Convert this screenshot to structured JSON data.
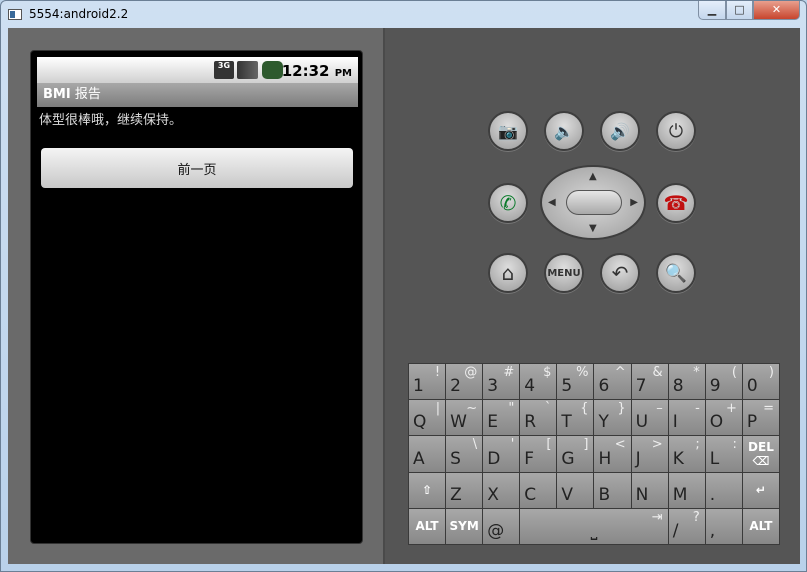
{
  "window": {
    "title": "5554:android2.2",
    "minimize": "▁",
    "maximize": "□",
    "close": "✕"
  },
  "status": {
    "network": "3G",
    "time": "12:32",
    "ampm": "PM"
  },
  "app": {
    "title_bold": "BMI",
    "title_rest": " 报告",
    "message": "体型很棒哦，继续保持。",
    "prev_button": "前一页"
  },
  "controls": {
    "menu": "MENU"
  },
  "keyboard": [
    [
      {
        "m": "1",
        "a": "!"
      },
      {
        "m": "2",
        "a": "@"
      },
      {
        "m": "3",
        "a": "#"
      },
      {
        "m": "4",
        "a": "$"
      },
      {
        "m": "5",
        "a": "%"
      },
      {
        "m": "6",
        "a": "^"
      },
      {
        "m": "7",
        "a": "&"
      },
      {
        "m": "8",
        "a": "*"
      },
      {
        "m": "9",
        "a": "("
      },
      {
        "m": "0",
        "a": ")"
      }
    ],
    [
      {
        "m": "Q",
        "a": "|"
      },
      {
        "m": "W",
        "a": "~"
      },
      {
        "m": "E",
        "a": "\""
      },
      {
        "m": "R",
        "a": "`"
      },
      {
        "m": "T",
        "a": "{"
      },
      {
        "m": "Y",
        "a": "}"
      },
      {
        "m": "U",
        "a": "–"
      },
      {
        "m": "I",
        "a": "-"
      },
      {
        "m": "O",
        "a": "+"
      },
      {
        "m": "P",
        "a": "="
      }
    ],
    [
      {
        "m": "A",
        "a": ""
      },
      {
        "m": "S",
        "a": "\\"
      },
      {
        "m": "D",
        "a": "'"
      },
      {
        "m": "F",
        "a": "["
      },
      {
        "m": "G",
        "a": "]"
      },
      {
        "m": "H",
        "a": "<"
      },
      {
        "m": "J",
        "a": ">"
      },
      {
        "m": "K",
        "a": ";"
      },
      {
        "m": "L",
        "a": ":"
      },
      {
        "c": "DEL ⌫",
        "name": "delete"
      }
    ],
    [
      {
        "c": "⇧",
        "name": "shift"
      },
      {
        "m": "Z",
        "a": ""
      },
      {
        "m": "X",
        "a": ""
      },
      {
        "m": "C",
        "a": ""
      },
      {
        "m": "V",
        "a": ""
      },
      {
        "m": "B",
        "a": ""
      },
      {
        "m": "N",
        "a": ""
      },
      {
        "m": "M",
        "a": ""
      },
      {
        "m": ".",
        "a": ""
      },
      {
        "c": "↵",
        "name": "enter"
      }
    ],
    [
      {
        "c": "ALT",
        "name": "alt-left"
      },
      {
        "c": "SYM",
        "name": "sym"
      },
      {
        "m": "@",
        "a": ""
      },
      {
        "m": "⎵",
        "a": "⇥",
        "span": 4,
        "name": "space"
      },
      {
        "m": "/",
        "a": "?"
      },
      {
        "m": ",",
        "a": ""
      },
      {
        "c": "ALT",
        "name": "alt-right"
      }
    ]
  ]
}
